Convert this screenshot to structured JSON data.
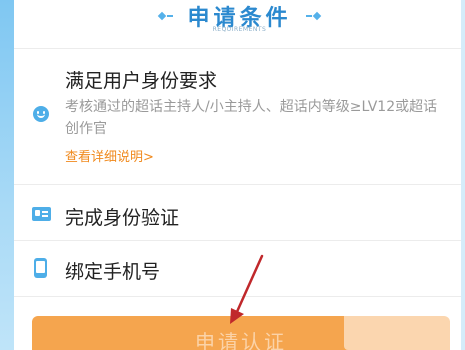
{
  "header": {
    "title": "申请条件",
    "subtitle": "REQUIREMENTS"
  },
  "requirements": [
    {
      "icon": "smiley-icon",
      "title": "满足用户身份要求",
      "description": "考核通过的超话主持人/小主持人、超话内等级≥LV12或超话创作官",
      "link": "查看详细说明>"
    },
    {
      "icon": "id-card-icon",
      "title": "完成身份验证"
    },
    {
      "icon": "mobile-phone-icon",
      "title": "绑定手机号"
    }
  ],
  "apply_button": {
    "label": "申请认证"
  },
  "colors": {
    "accent_blue": "#4eaee8",
    "title_blue": "#2b89cf",
    "link_orange": "#f08a1e",
    "button_orange": "#f5a54e",
    "annotation_red": "#c0282b"
  }
}
